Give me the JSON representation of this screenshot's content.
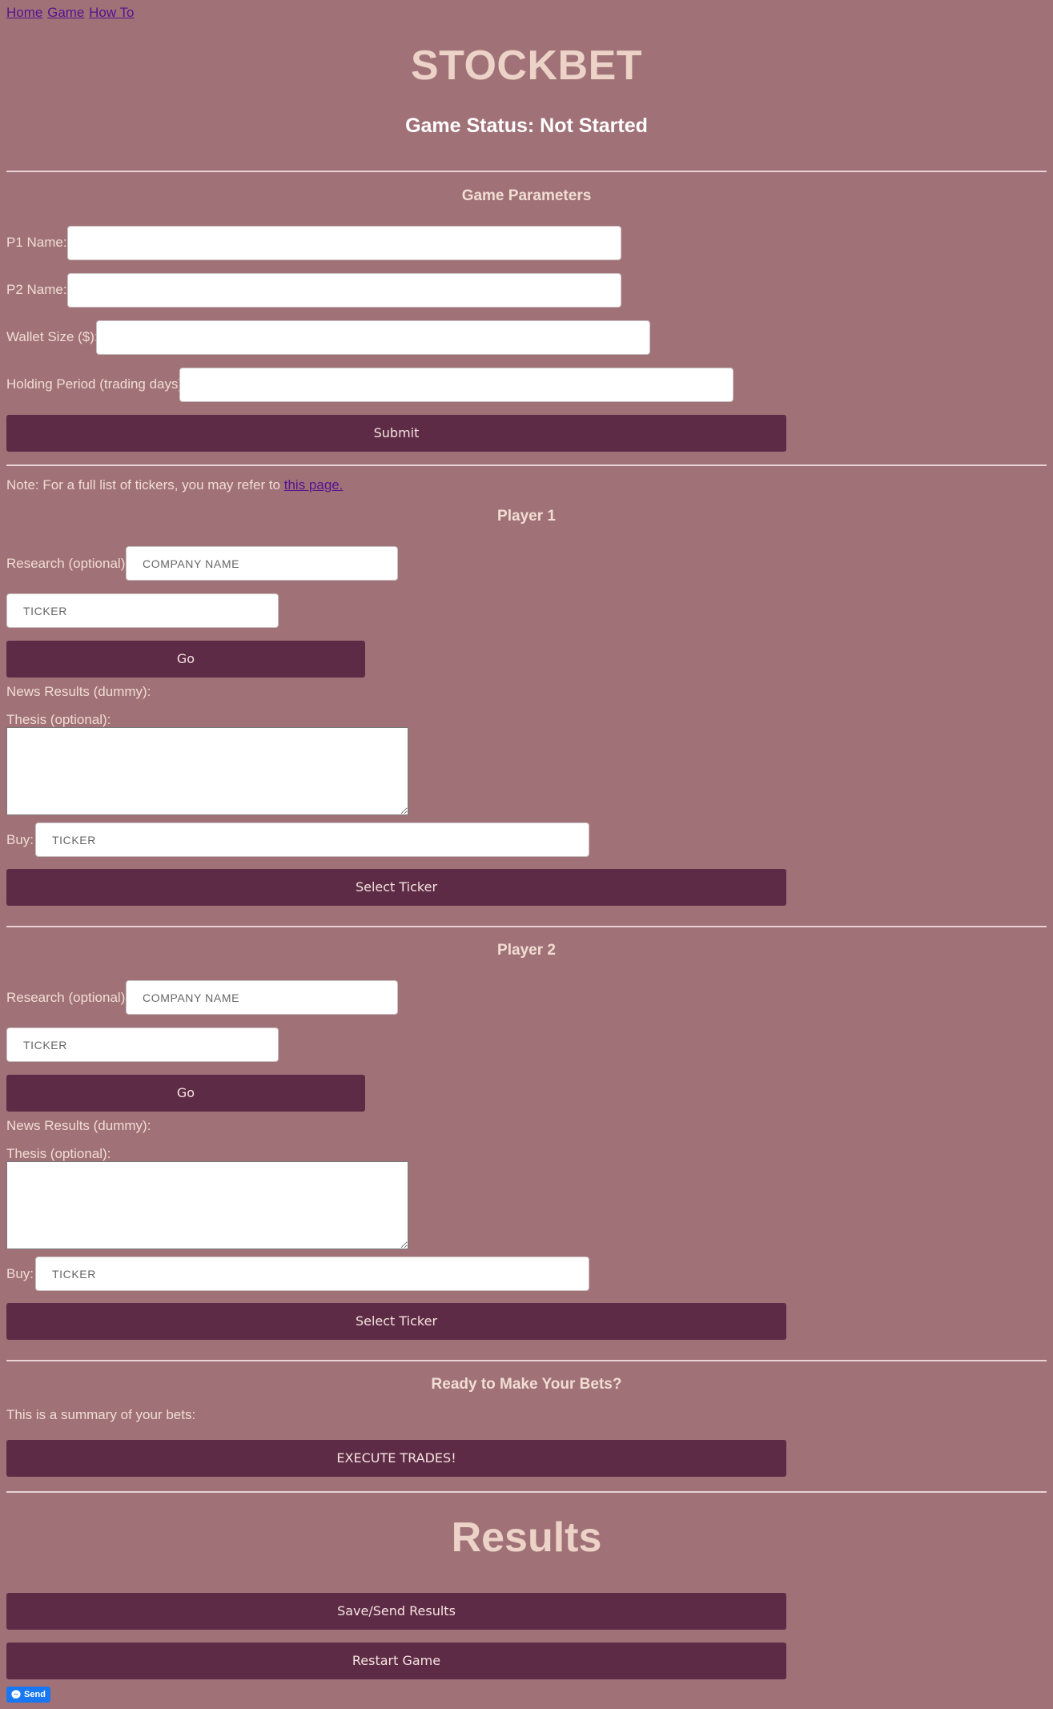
{
  "nav": {
    "items": [
      {
        "label": "Home"
      },
      {
        "label": "Game"
      },
      {
        "label": "How To"
      }
    ]
  },
  "header": {
    "title": "STOCKBET",
    "status": "Game Status: Not Started"
  },
  "parameters": {
    "heading": "Game Parameters",
    "p1_label": "P1 Name:",
    "p2_label": "P2 Name:",
    "wallet_label": "Wallet Size ($):",
    "holding_label": "Holding Period (trading days):",
    "submit_label": "Submit"
  },
  "note": {
    "text": "Note: For a full list of tickers, you may refer to",
    "link": "this page."
  },
  "players": [
    {
      "heading": "Player 1",
      "research_label": "Research (optional):",
      "company_placeholder": "COMPANY NAME",
      "ticker_placeholder": "TICKER",
      "go_label": "Go",
      "news_label": "News Results (dummy):",
      "thesis_label": "Thesis (optional):",
      "buy_label": "Buy:",
      "buy_placeholder": "TICKER",
      "select_label": "Select Ticker"
    },
    {
      "heading": "Player 2",
      "research_label": "Research (optional):",
      "company_placeholder": "COMPANY NAME",
      "ticker_placeholder": "TICKER",
      "go_label": "Go",
      "news_label": "News Results (dummy):",
      "thesis_label": "Thesis (optional):",
      "buy_label": "Buy:",
      "buy_placeholder": "TICKER",
      "select_label": "Select Ticker"
    }
  ],
  "bets": {
    "heading": "Ready to Make Your Bets?",
    "summary": "This is a summary of your bets:",
    "execute_label": "EXECUTE TRADES!"
  },
  "results": {
    "title": "Results",
    "save_label": "Save/Send Results",
    "restart_label": "Restart Game"
  },
  "messenger": {
    "send_label": "Send",
    "icon": "messenger-icon"
  },
  "colors": {
    "background": "#a07278",
    "button": "#5e2b47",
    "text": "#f1ddd2",
    "link": "#55138f",
    "send_button": "#1877f2"
  }
}
